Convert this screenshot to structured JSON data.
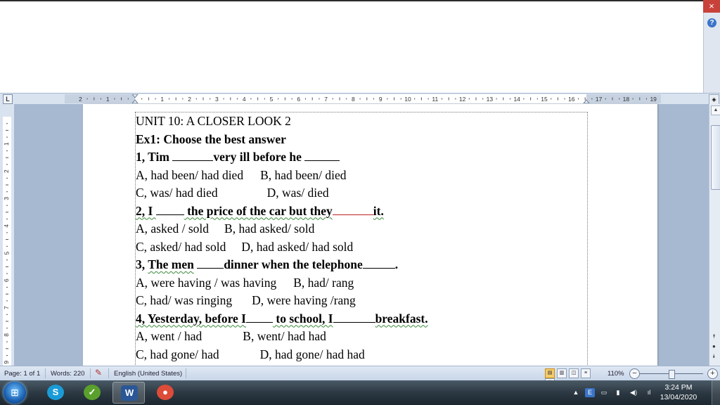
{
  "window": {
    "close_glyph": "×",
    "help_glyph": "?"
  },
  "ruler": {
    "corner_label": "L",
    "left_labels": [
      "2",
      "1"
    ],
    "right_labels": [
      "1",
      "2",
      "3",
      "4",
      "5",
      "6",
      "7",
      "8",
      "9",
      "10",
      "11",
      "12",
      "13",
      "14",
      "15",
      "16",
      "17",
      "18",
      "19"
    ],
    "vertical_labels": [
      "1",
      "2",
      "3",
      "4",
      "5",
      "6",
      "7",
      "8",
      "9"
    ]
  },
  "document": {
    "lines": [
      {
        "segments": [
          {
            "t": "UNIT 10: A CLOSER LOOK 2"
          }
        ]
      },
      {
        "bold": true,
        "segments": [
          {
            "t": "Ex1: Choose the best answer"
          }
        ]
      },
      {
        "bold": true,
        "segments": [
          {
            "t": "1, Tim "
          },
          {
            "blank": 58
          },
          {
            "t": "very ill before he "
          },
          {
            "blank": 50
          }
        ]
      },
      {
        "segments": [
          {
            "t": "A, had been/ had died"
          },
          {
            "gap": 24
          },
          {
            "t": "B, had been/ died"
          }
        ]
      },
      {
        "segments": [
          {
            "t": "C, was/ had died"
          },
          {
            "gap": 70
          },
          {
            "t": "D, was/ died"
          }
        ]
      },
      {
        "bold": true,
        "squig": "g",
        "segments": [
          {
            "t": "2, I "
          },
          {
            "blank": 40
          },
          {
            "t": " the price of the car but they"
          },
          {
            "blank": 58,
            "red": true
          },
          {
            "t": "it."
          }
        ]
      },
      {
        "segments": [
          {
            "t": "A, asked / sold"
          },
          {
            "gap": 22
          },
          {
            "t": "B, had asked/ sold"
          }
        ]
      },
      {
        "segments": [
          {
            "t": "C, asked/ had sold"
          },
          {
            "gap": 22
          },
          {
            "t": "D, had asked/ had sold"
          }
        ]
      },
      {
        "bold": true,
        "segments": [
          {
            "t": "3, "
          },
          {
            "t": "The men",
            "squig": "g"
          },
          {
            "t": " "
          },
          {
            "blank": 38
          },
          {
            "t": "dinner when the telephone"
          },
          {
            "blank": 46
          },
          {
            "t": "."
          }
        ]
      },
      {
        "segments": [
          {
            "t": "A, were having / was having"
          },
          {
            "gap": 24
          },
          {
            "t": "B, had/ rang"
          }
        ]
      },
      {
        "segments": [
          {
            "t": "C, had/ was ringing"
          },
          {
            "gap": 28
          },
          {
            "t": "D, were having /rang"
          }
        ]
      },
      {
        "bold": true,
        "squig": "g",
        "segments": [
          {
            "t": "4, Yesterday, before I"
          },
          {
            "blank": 38
          },
          {
            "t": " to school, I"
          },
          {
            "blank": 60
          },
          {
            "t": "breakfast."
          }
        ]
      },
      {
        "segments": [
          {
            "t": "A, went / had"
          },
          {
            "gap": 58
          },
          {
            "t": "B, went/ had had"
          }
        ]
      },
      {
        "segments": [
          {
            "t": "C, had gone/ had"
          },
          {
            "gap": 58
          },
          {
            "t": "D, had gone/ had had"
          }
        ]
      }
    ]
  },
  "status": {
    "page": "Page: 1 of 1",
    "words": "Words: 220",
    "language": "English (United States)",
    "zoom": "110%",
    "zoom_fraction": 0.5,
    "zoom_minus": "−",
    "zoom_plus": "+"
  },
  "taskbar": {
    "apps": [
      {
        "name": "skype",
        "glyph": "S",
        "color": "#1a9bd7"
      },
      {
        "name": "app-green",
        "glyph": "✓",
        "color": "#5aa02c"
      },
      {
        "name": "word",
        "glyph": "W",
        "color": "#2b5797",
        "active": true
      },
      {
        "name": "chrome",
        "glyph": "●",
        "color": "#dd4b39"
      }
    ],
    "time": "3:24 PM",
    "date": "13/04/2020",
    "tray_glyphs": [
      "▲",
      "E",
      "▭",
      "▮",
      "◀)",
      "ıl"
    ]
  },
  "colors": {
    "doc_bg": "#a7b9d1",
    "ruler_bg": "#d9e3f0",
    "taskbar": "#2a3640"
  }
}
